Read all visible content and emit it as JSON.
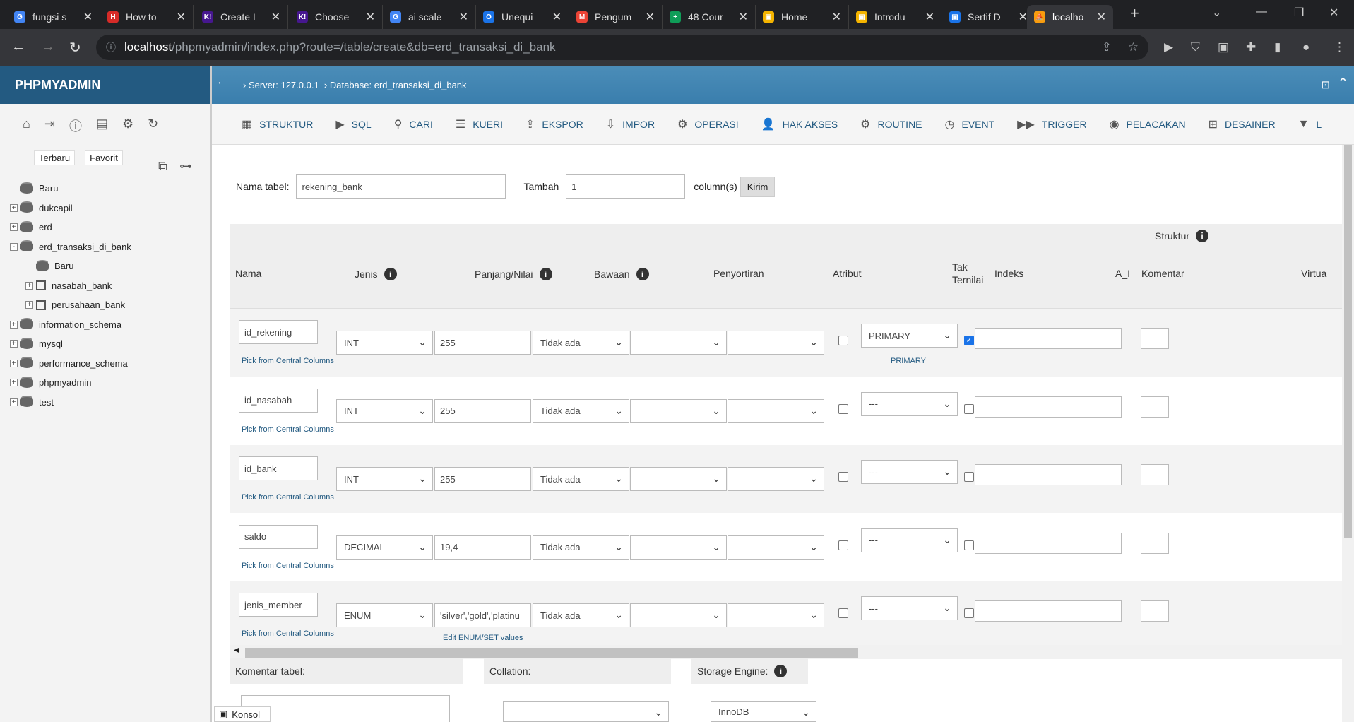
{
  "browser": {
    "tabs": [
      {
        "label": "fungsi s",
        "color": "#4285f4",
        "glyph": "G"
      },
      {
        "label": "How to",
        "color": "#d62b28",
        "glyph": "H"
      },
      {
        "label": "Create I",
        "color": "#46178f",
        "glyph": "K!"
      },
      {
        "label": "Choose",
        "color": "#46178f",
        "glyph": "K!"
      },
      {
        "label": "ai scale",
        "color": "#4285f4",
        "glyph": "G"
      },
      {
        "label": "Unequi",
        "color": "#1a73e8",
        "glyph": "O"
      },
      {
        "label": "Pengum",
        "color": "#ea4335",
        "glyph": "M"
      },
      {
        "label": "48 Cour",
        "color": "#0f9d58",
        "glyph": "+"
      },
      {
        "label": "Home",
        "color": "#f4b400",
        "glyph": "▣"
      },
      {
        "label": "Introdu",
        "color": "#f4b400",
        "glyph": "▣"
      },
      {
        "label": "Sertif D",
        "color": "#1a73e8",
        "glyph": "▣"
      },
      {
        "label": "localho",
        "color": "#f89c0e",
        "glyph": "⛵"
      }
    ],
    "url_host": "localhost",
    "url_path": "/phpmyadmin/index.php?route=/table/create&db=erd_transaksi_di_bank"
  },
  "sidebar": {
    "logo": "PHPMYADMIN",
    "tabs": [
      "Terbaru",
      "Favorit"
    ],
    "tree": [
      {
        "label": "Baru",
        "level": 0,
        "type": "new"
      },
      {
        "label": "dukcapil",
        "level": 0,
        "type": "db",
        "expander": "+"
      },
      {
        "label": "erd",
        "level": 0,
        "type": "db",
        "expander": "+"
      },
      {
        "label": "erd_transaksi_di_bank",
        "level": 0,
        "type": "db",
        "expander": "-"
      },
      {
        "label": "Baru",
        "level": 1,
        "type": "new"
      },
      {
        "label": "nasabah_bank",
        "level": 1,
        "type": "table",
        "expander": "+"
      },
      {
        "label": "perusahaan_bank",
        "level": 1,
        "type": "table",
        "expander": "+"
      },
      {
        "label": "information_schema",
        "level": 0,
        "type": "db",
        "expander": "+"
      },
      {
        "label": "mysql",
        "level": 0,
        "type": "db",
        "expander": "+"
      },
      {
        "label": "performance_schema",
        "level": 0,
        "type": "db",
        "expander": "+"
      },
      {
        "label": "phpmyadmin",
        "level": 0,
        "type": "db",
        "expander": "+"
      },
      {
        "label": "test",
        "level": 0,
        "type": "db",
        "expander": "+"
      }
    ]
  },
  "breadcrumb": {
    "server": "Server: 127.0.0.1",
    "database": "Database: erd_transaksi_di_bank"
  },
  "menu": [
    {
      "label": "STRUKTUR",
      "icon": "structure-icon",
      "glyph": "▦"
    },
    {
      "label": "SQL",
      "icon": "sql-icon",
      "glyph": "▶"
    },
    {
      "label": "CARI",
      "icon": "search-icon",
      "glyph": "⚲"
    },
    {
      "label": "KUERI",
      "icon": "query-icon",
      "glyph": "☰"
    },
    {
      "label": "EKSPOR",
      "icon": "export-icon",
      "glyph": "⇪"
    },
    {
      "label": "IMPOR",
      "icon": "import-icon",
      "glyph": "⇩"
    },
    {
      "label": "OPERASI",
      "icon": "gear-icon",
      "glyph": "⚙"
    },
    {
      "label": "HAK AKSES",
      "icon": "user-icon",
      "glyph": "👤"
    },
    {
      "label": "ROUTINE",
      "icon": "routine-icon",
      "glyph": "⚙"
    },
    {
      "label": "EVENT",
      "icon": "clock-icon",
      "glyph": "◷"
    },
    {
      "label": "TRIGGER",
      "icon": "trigger-icon",
      "glyph": "▶▶"
    },
    {
      "label": "PELACAKAN",
      "icon": "eye-icon",
      "glyph": "◉"
    },
    {
      "label": "DESAINER",
      "icon": "designer-icon",
      "glyph": "⊞"
    },
    {
      "label": "L",
      "icon": "chevron-down-icon",
      "glyph": "▼"
    }
  ],
  "form": {
    "table_name_label": "Nama tabel:",
    "table_name": "rekening_bank",
    "add_label": "Tambah",
    "add_count": "1",
    "columns_label": "column(s)",
    "submit": "Kirim"
  },
  "headers": {
    "struktur": "Struktur",
    "nama": "Nama",
    "jenis": "Jenis",
    "panjang": "Panjang/Nilai",
    "bawaan": "Bawaan",
    "penyortiran": "Penyortiran",
    "atribut": "Atribut",
    "tak_ternilai": "Tak Ternilai",
    "indeks": "Indeks",
    "ai": "A_I",
    "komentar": "Komentar",
    "virtual": "Virtua"
  },
  "columns": [
    {
      "name": "id_rekening",
      "type": "INT",
      "length": "255",
      "default": "Tidak ada",
      "index": "PRIMARY",
      "index_note": "PRIMARY",
      "ai": true,
      "extra_link": "Pick from Central Columns",
      "length_link": ""
    },
    {
      "name": "id_nasabah",
      "type": "INT",
      "length": "255",
      "default": "Tidak ada",
      "index": "---",
      "index_note": "",
      "ai": false,
      "extra_link": "Pick from Central Columns",
      "length_link": ""
    },
    {
      "name": "id_bank",
      "type": "INT",
      "length": "255",
      "default": "Tidak ada",
      "index": "---",
      "index_note": "",
      "ai": false,
      "extra_link": "Pick from Central Columns",
      "length_link": ""
    },
    {
      "name": "saldo",
      "type": "DECIMAL",
      "length": "19,4",
      "default": "Tidak ada",
      "index": "---",
      "index_note": "",
      "ai": false,
      "extra_link": "Pick from Central Columns",
      "length_link": ""
    },
    {
      "name": "jenis_member",
      "type": "ENUM",
      "length": "'silver','gold','platinu",
      "default": "Tidak ada",
      "index": "---",
      "index_note": "",
      "ai": false,
      "extra_link": "Pick from Central Columns",
      "length_link": "Edit ENUM/SET values"
    }
  ],
  "footer": {
    "comment_label": "Komentar tabel:",
    "collation_label": "Collation:",
    "engine_label": "Storage Engine:",
    "engine_value": "InnoDB",
    "console": "Konsol"
  }
}
